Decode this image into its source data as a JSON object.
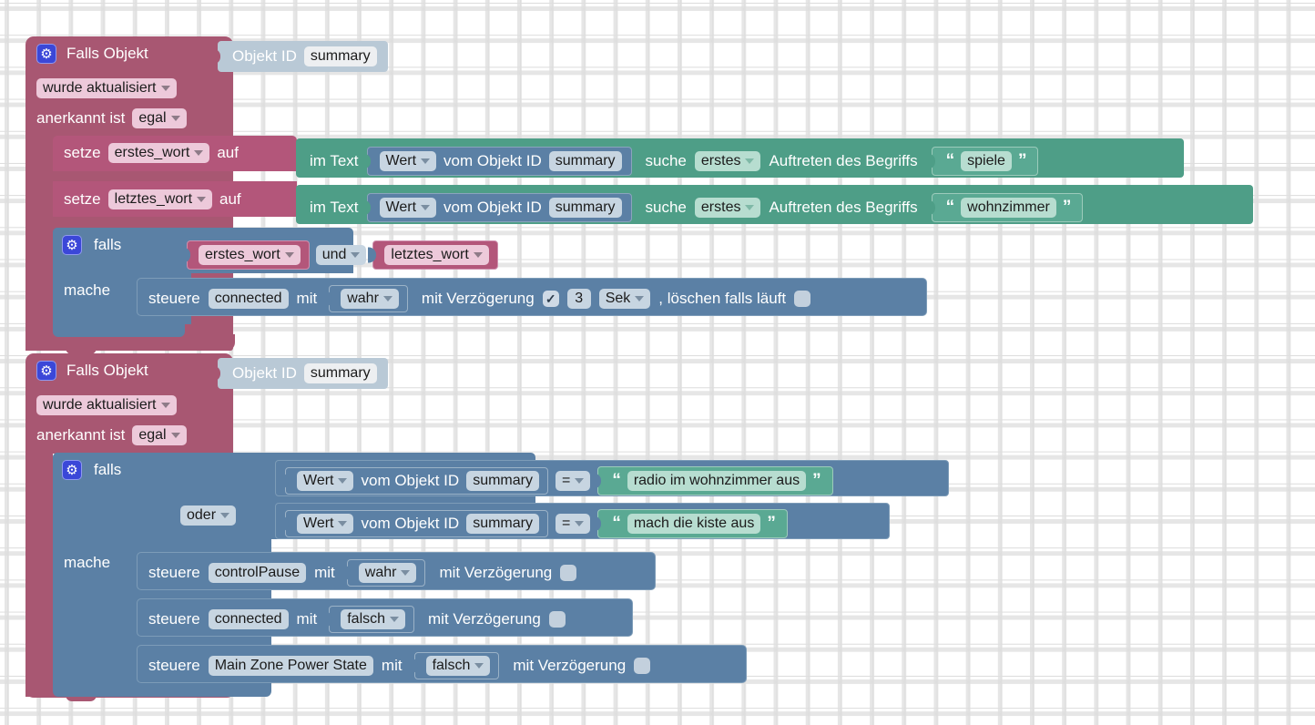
{
  "editor": {
    "name": "blockly-workspace",
    "grid_color": "#dcdcdc",
    "background": "#ffffff"
  },
  "colors": {
    "event": "#a85772",
    "variable": "#b3567a",
    "text": "#4e9e87",
    "string": "#5aa993",
    "control": "#5b80a5",
    "object_id": "#b9c9d6",
    "gear_icon": "#3b47d8"
  },
  "blocks": [
    {
      "id": "trigger-1",
      "type": "event",
      "title": "Falls Objekt",
      "gear_icon": "gear-icon",
      "object_id_label": "Objekt ID",
      "object_id_value": "summary",
      "condition_mode": "wurde aktualisiert",
      "ack_label": "anerkannt ist",
      "ack_value": "egal",
      "statements": [
        {
          "id": "set-1",
          "type": "variables_set",
          "keyword": "setze",
          "variable": "erstes_wort",
          "connector": "auf",
          "value": {
            "type": "text_indexof",
            "prefix": "im Text",
            "source": {
              "type": "get_value",
              "selector": "Wert",
              "mid": "vom Objekt ID",
              "object_id": "summary"
            },
            "search_label": "suche",
            "occurrence": "erstes",
            "suffix": "Auftreten des Begriffs",
            "needle": "spiele"
          }
        },
        {
          "id": "set-2",
          "type": "variables_set",
          "keyword": "setze",
          "variable": "letztes_wort",
          "connector": "auf",
          "value": {
            "type": "text_indexof",
            "prefix": "im Text",
            "source": {
              "type": "get_value",
              "selector": "Wert",
              "mid": "vom Objekt ID",
              "object_id": "summary"
            },
            "search_label": "suche",
            "occurrence": "erstes",
            "suffix": "Auftreten des Begriffs",
            "needle": "wohnzimmer"
          }
        },
        {
          "id": "if-1",
          "type": "controls_if",
          "gear_icon": "gear-icon",
          "if_label": "falls",
          "do_label": "mache",
          "condition": {
            "type": "logic_operation",
            "left": "erstes_wort",
            "operator": "und",
            "right": "letztes_wort"
          },
          "body": [
            {
              "type": "control",
              "keyword": "steuere",
              "object_id": "connected",
              "with_label": "mit",
              "value": "wahr",
              "delay_label": "mit Verzögerung",
              "delay_checked": true,
              "delay_amount": "3",
              "delay_unit": "Sek",
              "clear_label": ", löschen falls läuft",
              "clear_checked": false
            }
          ]
        }
      ]
    },
    {
      "id": "trigger-2",
      "type": "event",
      "title": "Falls Objekt",
      "gear_icon": "gear-icon",
      "object_id_label": "Objekt ID",
      "object_id_value": "summary",
      "condition_mode": "wurde aktualisiert",
      "ack_label": "anerkannt ist",
      "ack_value": "egal",
      "statements": [
        {
          "id": "if-2",
          "type": "controls_if",
          "gear_icon": "gear-icon",
          "if_label": "falls",
          "do_label": "mache",
          "condition": {
            "type": "logic_operation_multi",
            "operator": "oder",
            "rows": [
              {
                "source": {
                  "selector": "Wert",
                  "mid": "vom Objekt ID",
                  "object_id": "summary"
                },
                "comparator": "=",
                "literal": "radio im wohnzimmer aus"
              },
              {
                "source": {
                  "selector": "Wert",
                  "mid": "vom Objekt ID",
                  "object_id": "summary"
                },
                "comparator": "=",
                "literal": "mach die kiste aus"
              }
            ]
          },
          "body": [
            {
              "type": "control",
              "keyword": "steuere",
              "object_id": "controlPause",
              "with_label": "mit",
              "value": "wahr",
              "delay_label": "mit Verzögerung",
              "delay_checked": false
            },
            {
              "type": "control",
              "keyword": "steuere",
              "object_id": "connected",
              "with_label": "mit",
              "value": "falsch",
              "delay_label": "mit Verzögerung",
              "delay_checked": false
            },
            {
              "type": "control",
              "keyword": "steuere",
              "object_id": "Main Zone Power State",
              "with_label": "mit",
              "value": "falsch",
              "delay_label": "mit Verzögerung",
              "delay_checked": false
            }
          ]
        }
      ]
    }
  ]
}
